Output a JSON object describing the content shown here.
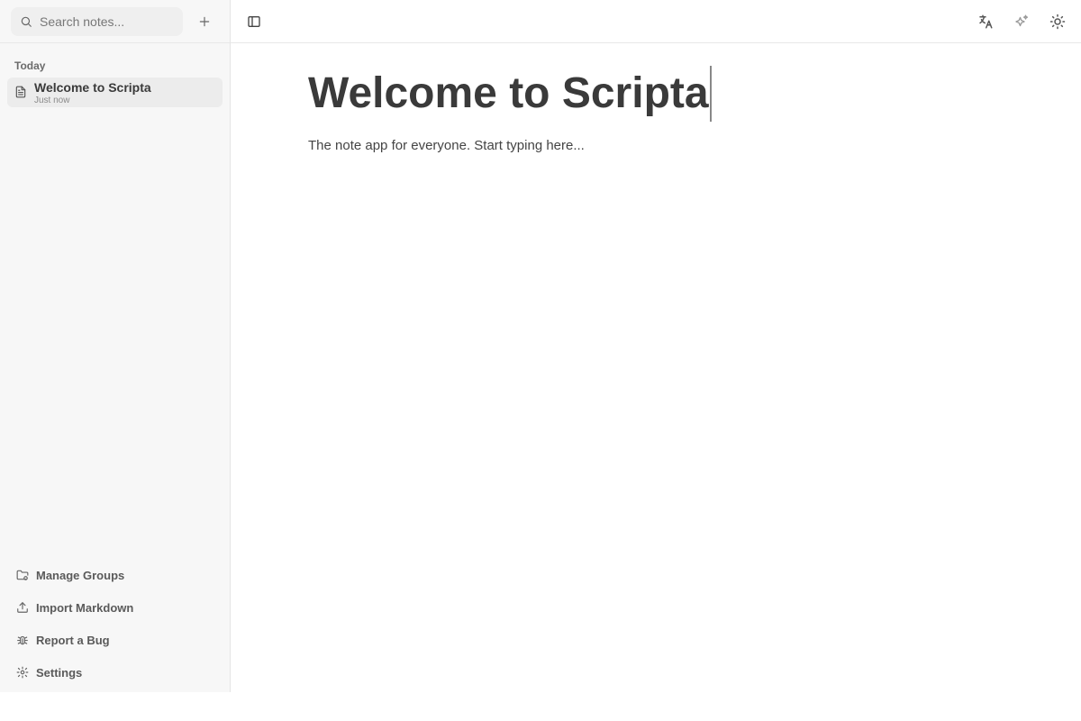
{
  "sidebar": {
    "search": {
      "placeholder": "Search notes..."
    },
    "section_label": "Today",
    "notes": [
      {
        "title": "Welcome to Scripta",
        "time": "Just now"
      }
    ],
    "bottom_items": [
      {
        "label": "Manage Groups",
        "icon": "folder-settings-icon"
      },
      {
        "label": "Import Markdown",
        "icon": "upload-icon"
      },
      {
        "label": "Report a Bug",
        "icon": "bug-icon"
      },
      {
        "label": "Settings",
        "icon": "gear-icon"
      }
    ]
  },
  "toolbar": {
    "icons": [
      "sidebar-toggle-icon",
      "translate-icon",
      "sparkles-icon",
      "sun-icon"
    ]
  },
  "editor": {
    "title": "Welcome to Scripta",
    "body": "The note app for everyone. Start typing here..."
  }
}
